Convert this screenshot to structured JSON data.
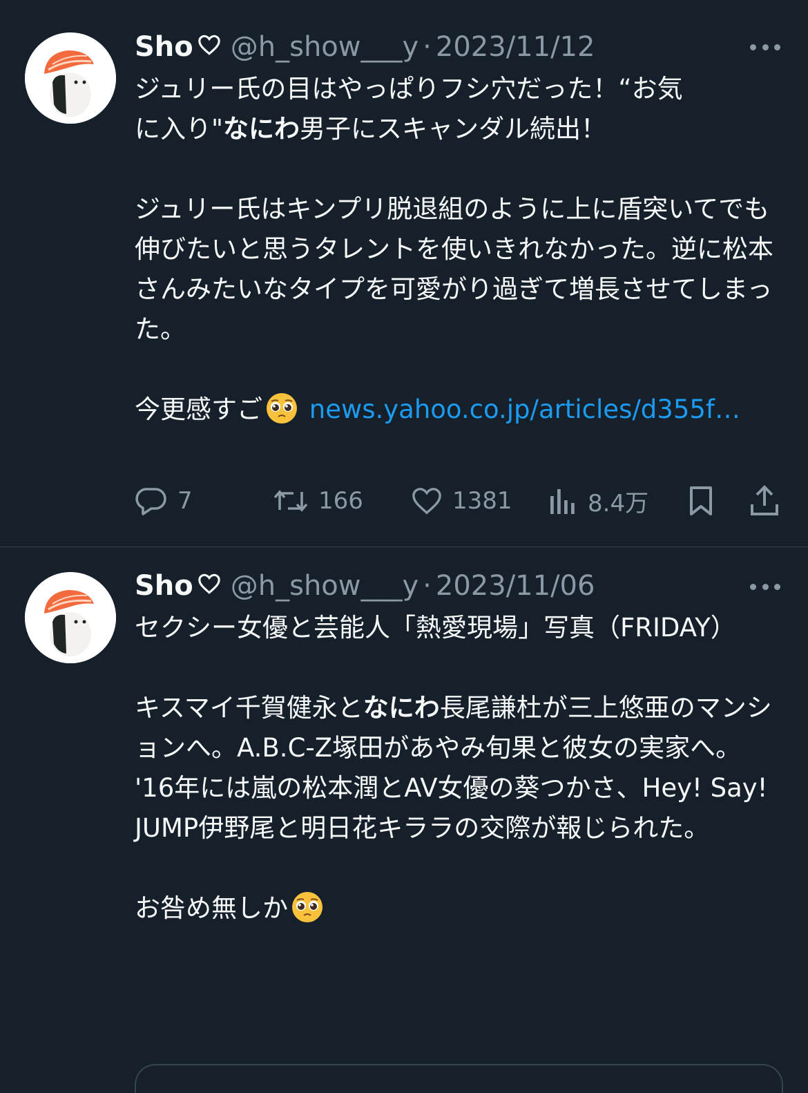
{
  "tweets": [
    {
      "display_name": "Sho",
      "handle": "@h_show___y",
      "separator": "·",
      "date": "2023/11/12",
      "body": {
        "line1_a": "ジュリー氏の目はやっぱりフシ穴だった！“お気",
        "line2_a": "に入り\"",
        "line2_bold": "なにわ",
        "line2_b": "男子にスキャンダル続出！",
        "para2": "ジュリー氏はキンプリ脱退組のように上に盾突いてでも伸びたいと思うタレントを使いきれなかった。逆に松本さんみたいなタイプを可愛がり過ぎて増長させてしまった。",
        "para3_text": "今更感すご",
        "link": "news.yahoo.co.jp/articles/d355f…"
      },
      "stats": {
        "replies": "7",
        "retweets": "166",
        "likes": "1381",
        "views": "8.4万"
      }
    },
    {
      "display_name": "Sho",
      "handle": "@h_show___y",
      "separator": "·",
      "date": "2023/11/06",
      "body": {
        "para1": "セクシー女優と芸能人「熱愛現場」写真（FRIDAY）",
        "para2_a": "キスマイ千賀健永と",
        "para2_bold": "なにわ",
        "para2_b": "長尾謙杜が三上悠亜のマンションへ。A.B.C-Z塚田があやみ旬果と彼女の実家へ。",
        "para3": "'16年には嵐の松本潤とAV女優の葵つかさ、Hey! Say! JUMP伊野尾と明日花キララの交際が報じられた。",
        "para4_text": "お咎め無しか"
      }
    }
  ],
  "icons": {
    "avatar": "salmon-sushi-avatar",
    "verified_heart": "heart-outline-icon",
    "more": "more-dots-icon",
    "reply": "reply-bubble-icon",
    "retweet": "retweet-icon",
    "like": "heart-icon",
    "views": "bar-chart-icon",
    "bookmark": "bookmark-icon",
    "share": "share-icon",
    "emoji": "pleading-face-emoji"
  },
  "colors": {
    "background": "#15202b",
    "text": "#f7f9f9",
    "muted": "#8b98a5",
    "link": "#1d9bf0",
    "divider": "#38444d"
  }
}
